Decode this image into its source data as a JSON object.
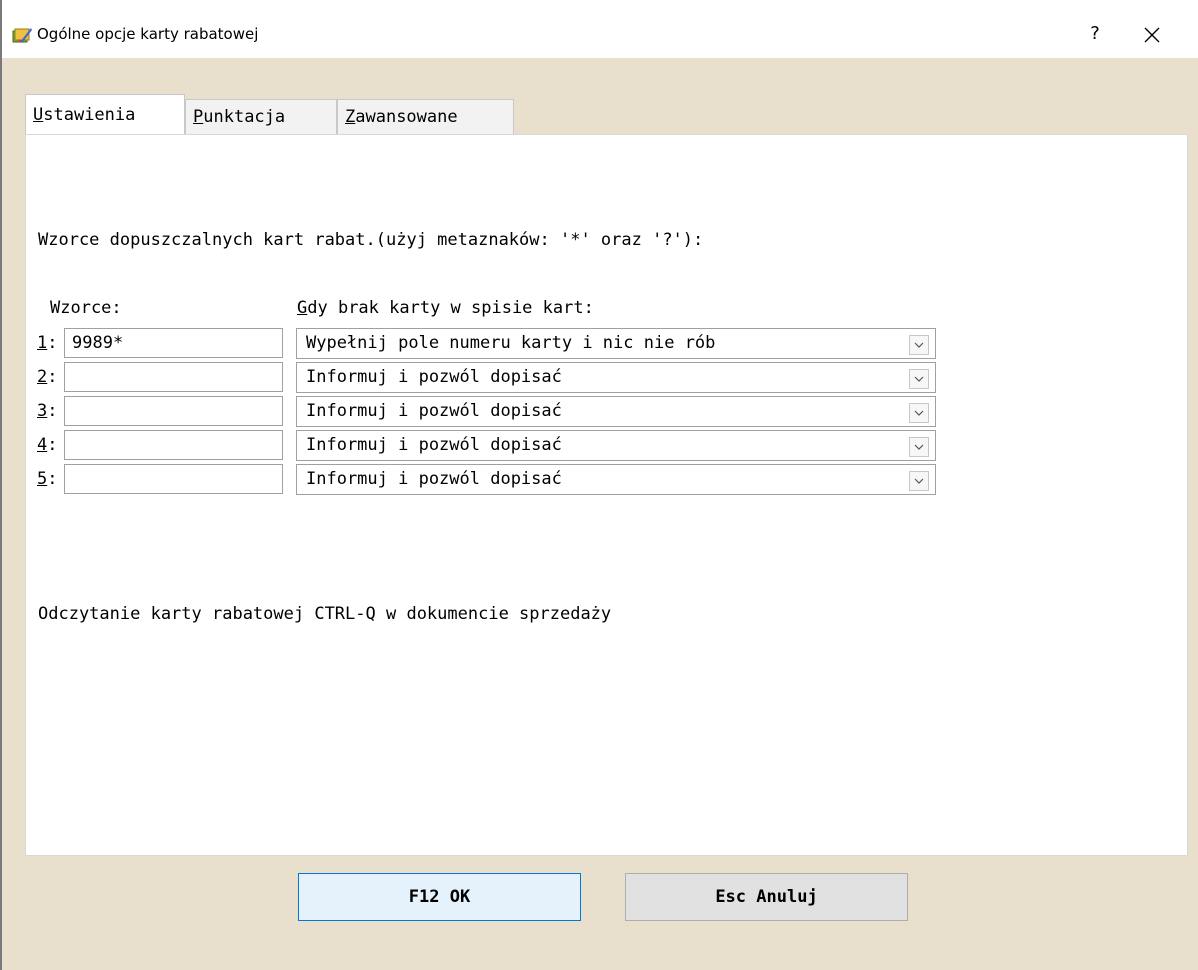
{
  "window": {
    "title": "Ogólne opcje karty rabatowej",
    "help_label": "?",
    "close_icon": "close-icon",
    "app_icon": "card-app-icon"
  },
  "tabs": [
    {
      "label_underlined": "U",
      "label_rest": "stawienia",
      "active": true
    },
    {
      "label_underlined": "P",
      "label_rest": "unktacja",
      "active": false
    },
    {
      "label_underlined": "Z",
      "label_rest": "awansowane",
      "active": false
    }
  ],
  "section": {
    "heading": "Wzorce dopuszczalnych kart rabat.(użyj metaznaków: '*' oraz '?'):",
    "patterns_header": "Wzorce:",
    "nocard_header_underlined": "G",
    "nocard_header_rest": "dy brak karty w spisie kart:"
  },
  "rows": [
    {
      "num": "1",
      "sep": ":",
      "pattern": "9989*",
      "action": "Wypełnij pole numeru karty i nic nie rób"
    },
    {
      "num": "2",
      "sep": ":",
      "pattern": "",
      "action": "Informuj i pozwól dopisać"
    },
    {
      "num": "3",
      "sep": ":",
      "pattern": "",
      "action": "Informuj i pozwól dopisać"
    },
    {
      "num": "4",
      "sep": ":",
      "pattern": "",
      "action": "Informuj i pozwól dopisać"
    },
    {
      "num": "5",
      "sep": ":",
      "pattern": "",
      "action": "Informuj i pozwól dopisać"
    }
  ],
  "note": "Odczytanie karty rabatowej CTRL-Q w dokumencie sprzedaży",
  "buttons": {
    "ok": "F12 OK",
    "cancel": "Esc Anuluj"
  },
  "colors": {
    "dialog_bg": "#e8e0cc",
    "ok_border": "#0078d7",
    "ok_bg": "#e5f1fb"
  }
}
